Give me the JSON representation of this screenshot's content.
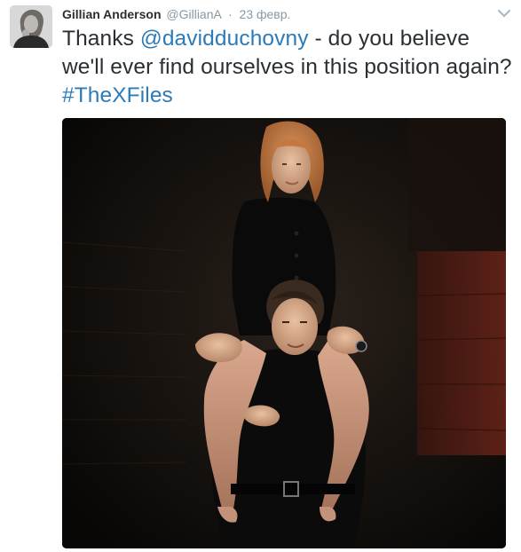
{
  "tweet": {
    "author_name": "Gillian Anderson",
    "author_handle": "@GillianA",
    "separator": "·",
    "timestamp": "23 февр.",
    "text_before_mention": "Thanks ",
    "mention": "@davidduchovny",
    "text_middle": " - do you believe we'll ever find ourselves in this position again? ",
    "hashtag": "#TheXFiles"
  },
  "icons": {
    "avatar": "author-avatar",
    "more": "chevron-down-icon"
  },
  "colors": {
    "link": "#2b7bb9",
    "name": "#292f33",
    "meta": "#8899a6",
    "photo_background": "#0b0a08"
  }
}
